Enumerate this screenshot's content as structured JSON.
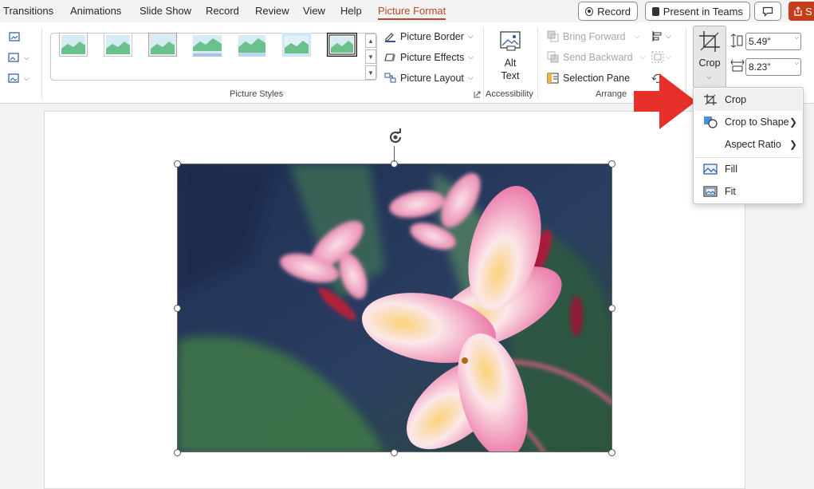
{
  "tabs": [
    {
      "label": "Transitions",
      "active": false
    },
    {
      "label": "Animations",
      "active": false
    },
    {
      "label": "Slide Show",
      "active": false
    },
    {
      "label": "Record",
      "active": false
    },
    {
      "label": "Review",
      "active": false
    },
    {
      "label": "View",
      "active": false
    },
    {
      "label": "Help",
      "active": false
    },
    {
      "label": "Picture Format",
      "active": true
    }
  ],
  "titlebar": {
    "record_label": "Record",
    "present_label": "Present in Teams",
    "share_label": "S"
  },
  "ribbon": {
    "picture_styles": {
      "group_label": "Picture Styles",
      "border_label": "Picture Border",
      "effects_label": "Picture Effects",
      "layout_label": "Picture Layout"
    },
    "accessibility": {
      "group_label": "Accessibility",
      "alt_text_line1": "Alt",
      "alt_text_line2": "Text"
    },
    "arrange": {
      "group_label": "Arrange",
      "bring_forward": "Bring Forward",
      "send_backward": "Send Backward",
      "selection_pane": "Selection Pane"
    },
    "size": {
      "crop_label": "Crop",
      "height_value": "5.49\"",
      "width_value": "8.23\""
    }
  },
  "crop_menu": {
    "items": [
      {
        "label": "Crop",
        "icon": "crop-icon",
        "submenu": false
      },
      {
        "label": "Crop to Shape",
        "icon": "crop-to-shape-icon",
        "submenu": true
      },
      {
        "label": "Aspect Ratio",
        "icon": "",
        "submenu": true
      },
      {
        "label": "Fill",
        "icon": "fill-icon",
        "submenu": false
      },
      {
        "label": "Fit",
        "icon": "fit-icon",
        "submenu": false
      }
    ]
  },
  "colors": {
    "accent": "#b7472a",
    "arrow": "#e8302a",
    "share": "#c43e1c"
  }
}
